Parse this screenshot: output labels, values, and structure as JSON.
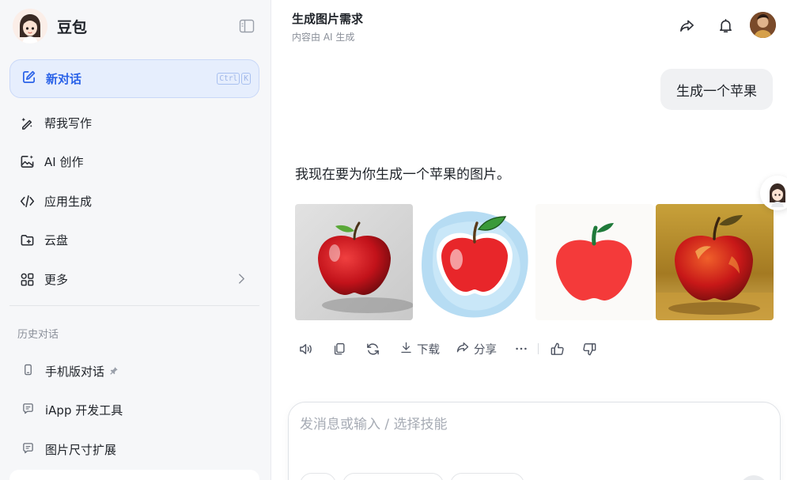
{
  "sidebar": {
    "brand": "豆包",
    "new_chat": {
      "label": "新对话",
      "shortcut": [
        "Ctrl",
        "K"
      ]
    },
    "nav": [
      {
        "label": "帮我写作",
        "icon": "pen-sparkle-icon"
      },
      {
        "label": "AI 创作",
        "icon": "image-sparkle-icon"
      },
      {
        "label": "应用生成",
        "icon": "code-icon"
      },
      {
        "label": "云盘",
        "icon": "cloud-folder-icon"
      },
      {
        "label": "更多",
        "icon": "grid-icon"
      }
    ],
    "history_title": "历史对话",
    "history": [
      {
        "label": "手机版对话",
        "icon": "phone-icon",
        "pinned": true
      },
      {
        "label": "iApp 开发工具",
        "icon": "chat-bubble-icon"
      },
      {
        "label": "图片尺寸扩展",
        "icon": "chat-bubble-icon"
      }
    ]
  },
  "header": {
    "title": "生成图片需求",
    "subtitle": "内容由 AI 生成"
  },
  "conversation": {
    "user_message": "生成一个苹果",
    "ai_message": "我现在要为你生成一个苹果的图片。",
    "images": [
      "realistic-apple",
      "watercolor-apple",
      "flat-apple",
      "oil-painting-apple"
    ],
    "actions": {
      "download": "下载",
      "share": "分享"
    }
  },
  "composer": {
    "placeholder": "发消息或输入 / 选择技能"
  },
  "colors": {
    "accent": "#2b63e8",
    "accent_bg": "#e6eefd",
    "sidebar_bg": "#f6f7f9"
  }
}
